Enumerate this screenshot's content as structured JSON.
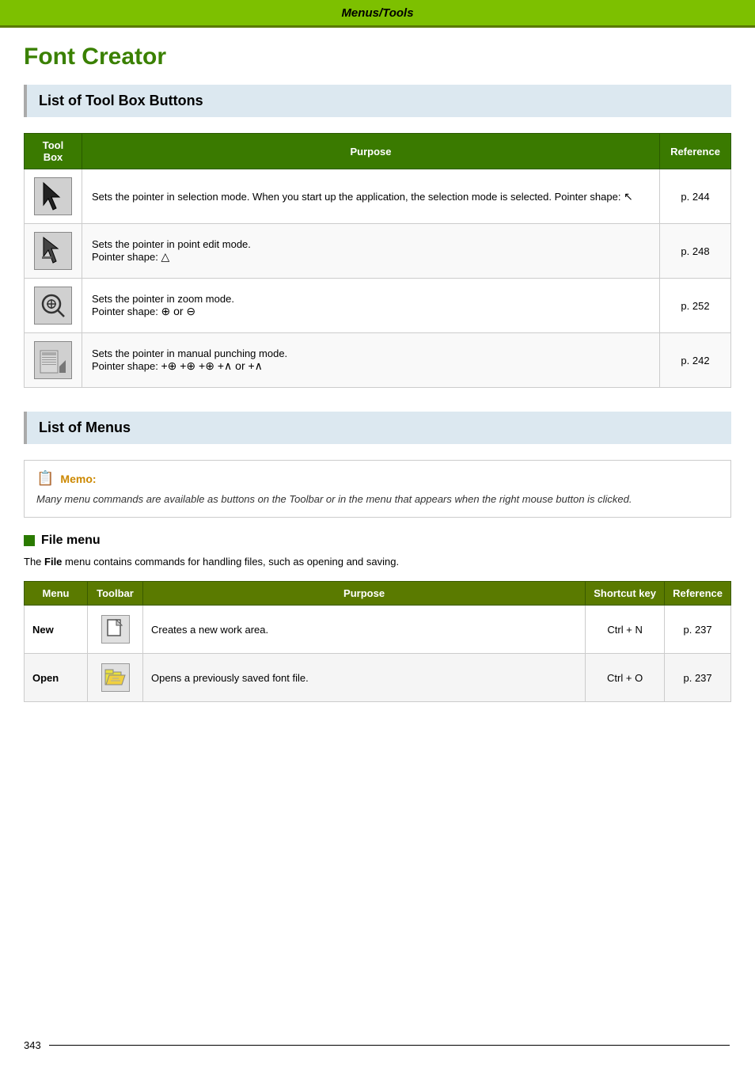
{
  "header": {
    "title": "Menus/Tools"
  },
  "page_title": "Font Creator",
  "tool_box_section": {
    "heading": "List of Tool Box Buttons",
    "table": {
      "columns": [
        "Tool Box",
        "Purpose",
        "Reference"
      ],
      "rows": [
        {
          "icon": "arrow",
          "purpose_main": "Sets the pointer in selection mode. When you start up the application, the selection mode is selected. Pointer shape:",
          "pointer_symbol": "↖",
          "reference": "p. 244"
        },
        {
          "icon": "arrow-edit",
          "purpose_main": "Sets the pointer in point edit mode.",
          "purpose_sub": "Pointer shape:",
          "pointer_symbol": "↗",
          "reference": "p. 248"
        },
        {
          "icon": "zoom",
          "purpose_main": "Sets the pointer in zoom mode.",
          "purpose_sub": "Pointer shape:",
          "pointer_symbol": "⊕ or ⊖",
          "reference": "p. 252"
        },
        {
          "icon": "punch",
          "purpose_main": "Sets the pointer in manual punching mode.",
          "purpose_sub": "Pointer shape:",
          "pointer_symbol": "+⊕ +⊕ +⊕ +∧ or +∧",
          "reference": "p. 242"
        }
      ]
    }
  },
  "menus_section": {
    "heading": "List of Menus",
    "memo": {
      "label": "Memo:",
      "text": "Many menu commands are available as buttons on the Toolbar or in the menu that appears when the right mouse button is clicked."
    },
    "file_menu": {
      "heading": "File menu",
      "description_pre": "The ",
      "description_bold": "File",
      "description_post": " menu contains commands for handling files, such as opening and saving.",
      "table": {
        "columns": [
          "Menu",
          "Toolbar",
          "Purpose",
          "Shortcut key",
          "Reference"
        ],
        "rows": [
          {
            "menu": "New",
            "toolbar_icon": "new-file",
            "purpose": "Creates a new work area.",
            "shortcut": "Ctrl + N",
            "reference": "p. 237"
          },
          {
            "menu": "Open",
            "toolbar_icon": "open-file",
            "purpose": "Opens a previously saved font file.",
            "shortcut": "Ctrl + O",
            "reference": "p. 237"
          }
        ]
      }
    }
  },
  "footer": {
    "page_number": "343"
  }
}
